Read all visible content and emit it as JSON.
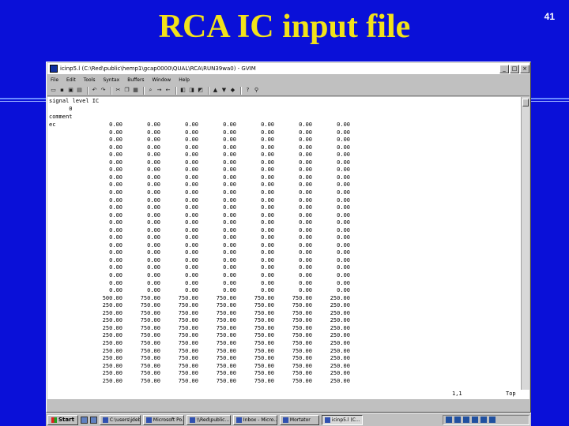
{
  "slide": {
    "title": "RCA IC input file",
    "number": "41"
  },
  "window": {
    "title": "icinp5.l (C:\\Red\\public\\hemp1\\gcap0000\\QUAL\\RCA\\RUN39wa0) - GVIM",
    "buttons": {
      "minimize": "_",
      "maximize": "□",
      "close": "×"
    }
  },
  "menu": [
    "File",
    "Edit",
    "Tools",
    "Syntax",
    "Buffers",
    "Window",
    "Help"
  ],
  "editor": {
    "header_lines": [
      "signal level IC",
      "      0",
      "comment",
      "ec"
    ],
    "rows": [
      [
        "0.00",
        "0.00",
        "0.00",
        "0.00",
        "0.00",
        "0.00",
        "0.00"
      ],
      [
        "0.00",
        "0.00",
        "0.00",
        "0.00",
        "0.00",
        "0.00",
        "0.00"
      ],
      [
        "0.00",
        "0.00",
        "0.00",
        "0.00",
        "0.00",
        "0.00",
        "0.00"
      ],
      [
        "0.00",
        "0.00",
        "0.00",
        "0.00",
        "0.00",
        "0.00",
        "0.00"
      ],
      [
        "0.00",
        "0.00",
        "0.00",
        "0.00",
        "0.00",
        "0.00",
        "0.00"
      ],
      [
        "0.00",
        "0.00",
        "0.00",
        "0.00",
        "0.00",
        "0.00",
        "0.00"
      ],
      [
        "0.00",
        "0.00",
        "0.00",
        "0.00",
        "0.00",
        "0.00",
        "0.00"
      ],
      [
        "0.00",
        "0.00",
        "0.00",
        "0.00",
        "0.00",
        "0.00",
        "0.00"
      ],
      [
        "0.00",
        "0.00",
        "0.00",
        "0.00",
        "0.00",
        "0.00",
        "0.00"
      ],
      [
        "0.00",
        "0.00",
        "0.00",
        "0.00",
        "0.00",
        "0.00",
        "0.00"
      ],
      [
        "0.00",
        "0.00",
        "0.00",
        "0.00",
        "0.00",
        "0.00",
        "0.00"
      ],
      [
        "0.00",
        "0.00",
        "0.00",
        "0.00",
        "0.00",
        "0.00",
        "0.00"
      ],
      [
        "0.00",
        "0.00",
        "0.00",
        "0.00",
        "0.00",
        "0.00",
        "0.00"
      ],
      [
        "0.00",
        "0.00",
        "0.00",
        "0.00",
        "0.00",
        "0.00",
        "0.00"
      ],
      [
        "0.00",
        "0.00",
        "0.00",
        "0.00",
        "0.00",
        "0.00",
        "0.00"
      ],
      [
        "0.00",
        "0.00",
        "0.00",
        "0.00",
        "0.00",
        "0.00",
        "0.00"
      ],
      [
        "0.00",
        "0.00",
        "0.00",
        "0.00",
        "0.00",
        "0.00",
        "0.00"
      ],
      [
        "0.00",
        "0.00",
        "0.00",
        "0.00",
        "0.00",
        "0.00",
        "0.00"
      ],
      [
        "0.00",
        "0.00",
        "0.00",
        "0.00",
        "0.00",
        "0.00",
        "0.00"
      ],
      [
        "0.00",
        "0.00",
        "0.00",
        "0.00",
        "0.00",
        "0.00",
        "0.00"
      ],
      [
        "0.00",
        "0.00",
        "0.00",
        "0.00",
        "0.00",
        "0.00",
        "0.00"
      ],
      [
        "0.00",
        "0.00",
        "0.00",
        "0.00",
        "0.00",
        "0.00",
        "0.00"
      ],
      [
        "0.00",
        "0.00",
        "0.00",
        "0.00",
        "0.00",
        "0.00",
        "0.00"
      ],
      [
        "500.00",
        "750.00",
        "750.00",
        "750.00",
        "750.00",
        "750.00",
        "250.00"
      ],
      [
        "250.00",
        "750.00",
        "750.00",
        "750.00",
        "750.00",
        "750.00",
        "250.00"
      ],
      [
        "250.00",
        "750.00",
        "750.00",
        "750.00",
        "750.00",
        "750.00",
        "250.00"
      ],
      [
        "250.00",
        "750.00",
        "750.00",
        "750.00",
        "750.00",
        "750.00",
        "250.00"
      ],
      [
        "250.00",
        "750.00",
        "750.00",
        "750.00",
        "750.00",
        "750.00",
        "250.00"
      ],
      [
        "250.00",
        "750.00",
        "750.00",
        "750.00",
        "750.00",
        "750.00",
        "250.00"
      ],
      [
        "250.00",
        "750.00",
        "750.00",
        "750.00",
        "750.00",
        "750.00",
        "250.00"
      ],
      [
        "250.00",
        "750.00",
        "750.00",
        "750.00",
        "750.00",
        "750.00",
        "250.00"
      ],
      [
        "250.00",
        "750.00",
        "750.00",
        "750.00",
        "750.00",
        "750.00",
        "250.00"
      ],
      [
        "250.00",
        "750.00",
        "750.00",
        "750.00",
        "750.00",
        "750.00",
        "250.00"
      ],
      [
        "250.00",
        "750.00",
        "750.00",
        "750.00",
        "750.00",
        "750.00",
        "250.00"
      ],
      [
        "250.00",
        "750.00",
        "750.00",
        "750.00",
        "750.00",
        "750.00",
        "250.00"
      ]
    ],
    "status_position": "1,1",
    "status_scroll": "Top"
  },
  "taskbar": {
    "start_label": "Start",
    "tasks": [
      "C:\\users\\jdeb...",
      "Microsoft Po...",
      "\\\\Red\\public...",
      "Inbox - Micro...",
      "Mortator",
      "icinp5.l (C..."
    ],
    "active_task": 5
  }
}
